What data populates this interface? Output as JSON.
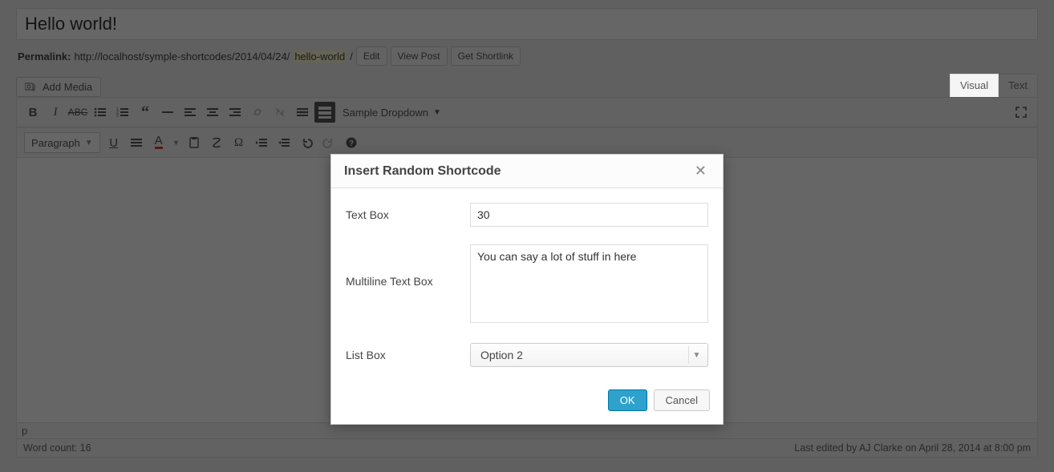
{
  "title_value": "Hello world!",
  "permalink": {
    "label": "Permalink:",
    "base": "http://localhost/symple-shortcodes/2014/04/24/",
    "slug": "hello-world",
    "trail": "/",
    "edit": "Edit",
    "view": "View Post",
    "shortlink": "Get Shortlink"
  },
  "media_button": "Add Media",
  "editor_tabs": {
    "visual": "Visual",
    "text": "Text"
  },
  "toolbar": {
    "dropdown": "Sample Dropdown",
    "paragraph": "Paragraph"
  },
  "status_path": "p",
  "footer": {
    "word_count_label": "Word count: ",
    "word_count_value": "16",
    "last_edited": "Last edited by AJ Clarke on April 28, 2014 at 8:00 pm"
  },
  "modal": {
    "title": "Insert Random Shortcode",
    "fields": {
      "textbox_label": "Text Box",
      "textbox_value": "30",
      "multiline_label": "Multiline Text Box",
      "multiline_value": "You can say a lot of stuff in here",
      "listbox_label": "List Box",
      "listbox_selected": "Option 2"
    },
    "ok": "OK",
    "cancel": "Cancel"
  }
}
